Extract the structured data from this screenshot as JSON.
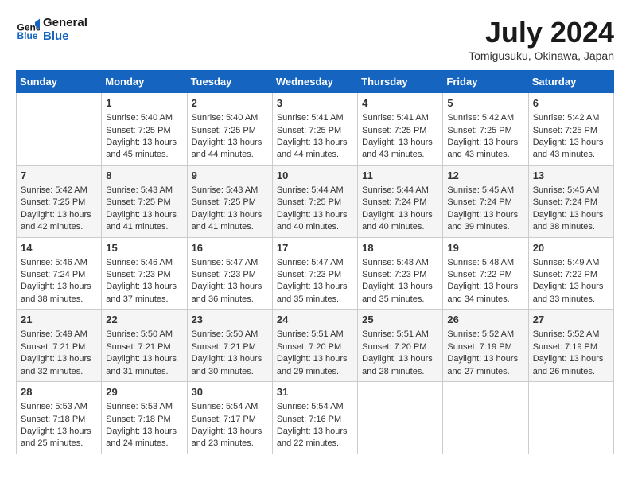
{
  "logo": {
    "line1": "General",
    "line2": "Blue"
  },
  "title": "July 2024",
  "subtitle": "Tomigusuku, Okinawa, Japan",
  "days_header": [
    "Sunday",
    "Monday",
    "Tuesday",
    "Wednesday",
    "Thursday",
    "Friday",
    "Saturday"
  ],
  "weeks": [
    [
      {
        "day": "",
        "sunrise": "",
        "sunset": "",
        "daylight": ""
      },
      {
        "day": "1",
        "sunrise": "Sunrise: 5:40 AM",
        "sunset": "Sunset: 7:25 PM",
        "daylight": "Daylight: 13 hours and 45 minutes."
      },
      {
        "day": "2",
        "sunrise": "Sunrise: 5:40 AM",
        "sunset": "Sunset: 7:25 PM",
        "daylight": "Daylight: 13 hours and 44 minutes."
      },
      {
        "day": "3",
        "sunrise": "Sunrise: 5:41 AM",
        "sunset": "Sunset: 7:25 PM",
        "daylight": "Daylight: 13 hours and 44 minutes."
      },
      {
        "day": "4",
        "sunrise": "Sunrise: 5:41 AM",
        "sunset": "Sunset: 7:25 PM",
        "daylight": "Daylight: 13 hours and 43 minutes."
      },
      {
        "day": "5",
        "sunrise": "Sunrise: 5:42 AM",
        "sunset": "Sunset: 7:25 PM",
        "daylight": "Daylight: 13 hours and 43 minutes."
      },
      {
        "day": "6",
        "sunrise": "Sunrise: 5:42 AM",
        "sunset": "Sunset: 7:25 PM",
        "daylight": "Daylight: 13 hours and 43 minutes."
      }
    ],
    [
      {
        "day": "7",
        "sunrise": "Sunrise: 5:42 AM",
        "sunset": "Sunset: 7:25 PM",
        "daylight": "Daylight: 13 hours and 42 minutes."
      },
      {
        "day": "8",
        "sunrise": "Sunrise: 5:43 AM",
        "sunset": "Sunset: 7:25 PM",
        "daylight": "Daylight: 13 hours and 41 minutes."
      },
      {
        "day": "9",
        "sunrise": "Sunrise: 5:43 AM",
        "sunset": "Sunset: 7:25 PM",
        "daylight": "Daylight: 13 hours and 41 minutes."
      },
      {
        "day": "10",
        "sunrise": "Sunrise: 5:44 AM",
        "sunset": "Sunset: 7:25 PM",
        "daylight": "Daylight: 13 hours and 40 minutes."
      },
      {
        "day": "11",
        "sunrise": "Sunrise: 5:44 AM",
        "sunset": "Sunset: 7:24 PM",
        "daylight": "Daylight: 13 hours and 40 minutes."
      },
      {
        "day": "12",
        "sunrise": "Sunrise: 5:45 AM",
        "sunset": "Sunset: 7:24 PM",
        "daylight": "Daylight: 13 hours and 39 minutes."
      },
      {
        "day": "13",
        "sunrise": "Sunrise: 5:45 AM",
        "sunset": "Sunset: 7:24 PM",
        "daylight": "Daylight: 13 hours and 38 minutes."
      }
    ],
    [
      {
        "day": "14",
        "sunrise": "Sunrise: 5:46 AM",
        "sunset": "Sunset: 7:24 PM",
        "daylight": "Daylight: 13 hours and 38 minutes."
      },
      {
        "day": "15",
        "sunrise": "Sunrise: 5:46 AM",
        "sunset": "Sunset: 7:23 PM",
        "daylight": "Daylight: 13 hours and 37 minutes."
      },
      {
        "day": "16",
        "sunrise": "Sunrise: 5:47 AM",
        "sunset": "Sunset: 7:23 PM",
        "daylight": "Daylight: 13 hours and 36 minutes."
      },
      {
        "day": "17",
        "sunrise": "Sunrise: 5:47 AM",
        "sunset": "Sunset: 7:23 PM",
        "daylight": "Daylight: 13 hours and 35 minutes."
      },
      {
        "day": "18",
        "sunrise": "Sunrise: 5:48 AM",
        "sunset": "Sunset: 7:23 PM",
        "daylight": "Daylight: 13 hours and 35 minutes."
      },
      {
        "day": "19",
        "sunrise": "Sunrise: 5:48 AM",
        "sunset": "Sunset: 7:22 PM",
        "daylight": "Daylight: 13 hours and 34 minutes."
      },
      {
        "day": "20",
        "sunrise": "Sunrise: 5:49 AM",
        "sunset": "Sunset: 7:22 PM",
        "daylight": "Daylight: 13 hours and 33 minutes."
      }
    ],
    [
      {
        "day": "21",
        "sunrise": "Sunrise: 5:49 AM",
        "sunset": "Sunset: 7:21 PM",
        "daylight": "Daylight: 13 hours and 32 minutes."
      },
      {
        "day": "22",
        "sunrise": "Sunrise: 5:50 AM",
        "sunset": "Sunset: 7:21 PM",
        "daylight": "Daylight: 13 hours and 31 minutes."
      },
      {
        "day": "23",
        "sunrise": "Sunrise: 5:50 AM",
        "sunset": "Sunset: 7:21 PM",
        "daylight": "Daylight: 13 hours and 30 minutes."
      },
      {
        "day": "24",
        "sunrise": "Sunrise: 5:51 AM",
        "sunset": "Sunset: 7:20 PM",
        "daylight": "Daylight: 13 hours and 29 minutes."
      },
      {
        "day": "25",
        "sunrise": "Sunrise: 5:51 AM",
        "sunset": "Sunset: 7:20 PM",
        "daylight": "Daylight: 13 hours and 28 minutes."
      },
      {
        "day": "26",
        "sunrise": "Sunrise: 5:52 AM",
        "sunset": "Sunset: 7:19 PM",
        "daylight": "Daylight: 13 hours and 27 minutes."
      },
      {
        "day": "27",
        "sunrise": "Sunrise: 5:52 AM",
        "sunset": "Sunset: 7:19 PM",
        "daylight": "Daylight: 13 hours and 26 minutes."
      }
    ],
    [
      {
        "day": "28",
        "sunrise": "Sunrise: 5:53 AM",
        "sunset": "Sunset: 7:18 PM",
        "daylight": "Daylight: 13 hours and 25 minutes."
      },
      {
        "day": "29",
        "sunrise": "Sunrise: 5:53 AM",
        "sunset": "Sunset: 7:18 PM",
        "daylight": "Daylight: 13 hours and 24 minutes."
      },
      {
        "day": "30",
        "sunrise": "Sunrise: 5:54 AM",
        "sunset": "Sunset: 7:17 PM",
        "daylight": "Daylight: 13 hours and 23 minutes."
      },
      {
        "day": "31",
        "sunrise": "Sunrise: 5:54 AM",
        "sunset": "Sunset: 7:16 PM",
        "daylight": "Daylight: 13 hours and 22 minutes."
      },
      {
        "day": "",
        "sunrise": "",
        "sunset": "",
        "daylight": ""
      },
      {
        "day": "",
        "sunrise": "",
        "sunset": "",
        "daylight": ""
      },
      {
        "day": "",
        "sunrise": "",
        "sunset": "",
        "daylight": ""
      }
    ]
  ]
}
